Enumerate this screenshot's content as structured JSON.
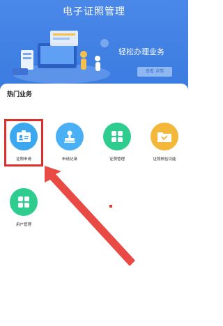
{
  "banner": {
    "title": "电子证照管理",
    "subtitle": "轻松办理业务",
    "button_label": "查看 详情"
  },
  "section": {
    "title": "热门业务"
  },
  "items": [
    {
      "label": "证照申请",
      "icon": "id-card-icon",
      "color": "#3ba7ee"
    },
    {
      "label": "申请记录",
      "icon": "stamp-icon",
      "color": "#49b0f5"
    },
    {
      "label": "证照管理",
      "icon": "grid-icon",
      "color": "#2ecc8f"
    },
    {
      "label": "证照核验功能",
      "icon": "folder-icon",
      "color": "#f3b739"
    },
    {
      "label": "用户管理",
      "icon": "grid-icon",
      "color": "#2ecc8f"
    }
  ],
  "colors": {
    "banner": "#4a88e8",
    "highlight": "#e02f2a",
    "arrow": "#ea4a44"
  }
}
